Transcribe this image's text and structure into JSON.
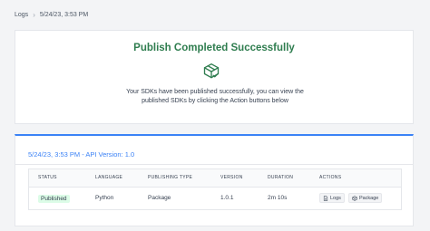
{
  "breadcrumb": {
    "root": "Logs",
    "separator": "›",
    "current": "5/24/23, 3:53 PM"
  },
  "success": {
    "title": "Publish Completed Successfully",
    "icon": "package-check-icon",
    "message": "Your SDKs have been published successfully, you can view the published SDKs by clicking the Action buttons below"
  },
  "history": {
    "title": "5/24/23, 3:53 PM - API Version: 1.0",
    "columns": [
      "STATUS",
      "LANGUAGE",
      "PUBLISHING TYPE",
      "VERSION",
      "DURATION",
      "ACTIONS"
    ],
    "row": {
      "status": "Published",
      "language": "Python",
      "publishing_type": "Package",
      "version": "1.0.1",
      "duration": "2m 10s",
      "actions": {
        "logs": "Logs",
        "package": "Package"
      }
    }
  },
  "colors": {
    "success": "#2f7d4f",
    "accent": "#3b82f6",
    "badge_bg": "#dcfce7",
    "badge_text": "#166534"
  }
}
